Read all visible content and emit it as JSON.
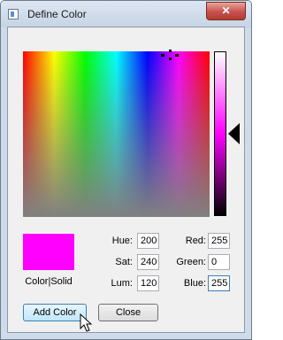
{
  "window": {
    "title": "Define Color",
    "close_label": "✕"
  },
  "swatch": {
    "label": "Color|Solid",
    "color": "#ff00ff"
  },
  "hsl": {
    "hue_label": "Hue:",
    "hue": "200",
    "sat_label": "Sat:",
    "sat": "240",
    "lum_label": "Lum:",
    "lum": "120"
  },
  "rgb": {
    "red_label": "Red:",
    "red": "255",
    "green_label": "Green:",
    "green": "0",
    "blue_label": "Blue:",
    "blue": "255"
  },
  "buttons": {
    "add_color": "Add Color",
    "close": "Close"
  }
}
